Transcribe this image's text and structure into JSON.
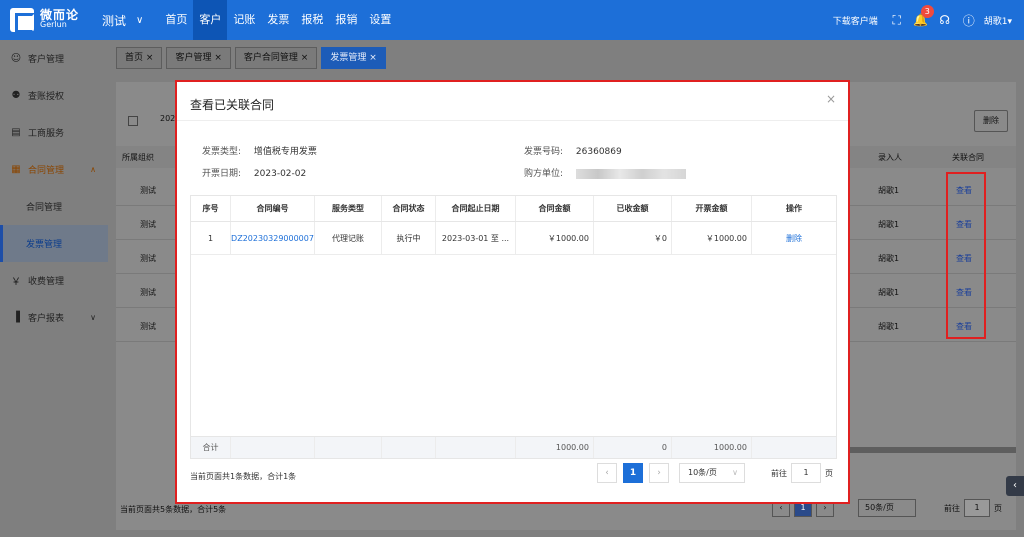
{
  "topbar": {
    "logo_cn": "微而论",
    "logo_en": "Gerlun",
    "company": "测试",
    "nav": [
      "首页",
      "客户",
      "记账",
      "发票",
      "报税",
      "报销",
      "设置"
    ],
    "active_nav": "客户",
    "download": "下载客户端",
    "notify_count": "3",
    "user": "胡歌1"
  },
  "sidebar": {
    "items": [
      {
        "label": "客户管理",
        "icon": "person-icon"
      },
      {
        "label": "查账授权",
        "icon": "person-key-icon"
      },
      {
        "label": "工商服务",
        "icon": "card-icon"
      },
      {
        "label": "合同管理",
        "icon": "contract-icon"
      },
      {
        "label": "合同管理",
        "icon": ""
      },
      {
        "label": "发票管理",
        "icon": ""
      },
      {
        "label": "收费管理",
        "icon": "yen-icon"
      },
      {
        "label": "客户报表",
        "icon": "chart-icon"
      }
    ]
  },
  "tabs": [
    "首页",
    "客户管理",
    "客户合同管理",
    "发票管理"
  ],
  "background": {
    "delete_label": "删除",
    "date_partial": "202",
    "headers": {
      "org": "所属组织",
      "entry": "录入人",
      "linked": "关联合同"
    },
    "rows": [
      {
        "org": "测试",
        "entry": "胡歌1",
        "link": "查看"
      },
      {
        "org": "测试",
        "entry": "胡歌1",
        "link": "查看"
      },
      {
        "org": "测试",
        "entry": "胡歌1",
        "link": "查看"
      },
      {
        "org": "测试",
        "entry": "胡歌1",
        "link": "查看"
      },
      {
        "org": "测试",
        "entry": "胡歌1",
        "link": "查看"
      }
    ],
    "footer": "当前页面共5条数据，合计5条",
    "page": "1",
    "page_size": "50条/页",
    "goto_label": "前往",
    "goto_value": "1",
    "goto_suffix": "页"
  },
  "modal": {
    "title": "查看已关联合同",
    "close": "×",
    "invoice_type_label": "发票类型:",
    "invoice_type": "增值税专用发票",
    "invoice_no_label": "发票号码:",
    "invoice_no": "26360869",
    "issue_date_label": "开票日期:",
    "issue_date": "2023-02-02",
    "buyer_label": "购方单位:",
    "columns": [
      "序号",
      "合同编号",
      "服务类型",
      "合同状态",
      "合同起止日期",
      "合同金额",
      "已收金额",
      "开票金额",
      "操作"
    ],
    "rows": [
      {
        "idx": "1",
        "code": "DZ20230329000007",
        "service": "代理记账",
        "status": "执行中",
        "dates": "2023-03-01 至 ...",
        "amount": "￥1000.00",
        "received": "￥0",
        "invoiced": "￥1000.00",
        "action": "删除"
      }
    ],
    "sum": {
      "label": "合计",
      "amount": "1000.00",
      "received": "0",
      "invoiced": "1000.00"
    },
    "footer": "当前页面共1条数据，合计1条",
    "page": "1",
    "page_size": "10条/页",
    "goto_label": "前往",
    "goto_value": "1",
    "goto_suffix": "页"
  }
}
